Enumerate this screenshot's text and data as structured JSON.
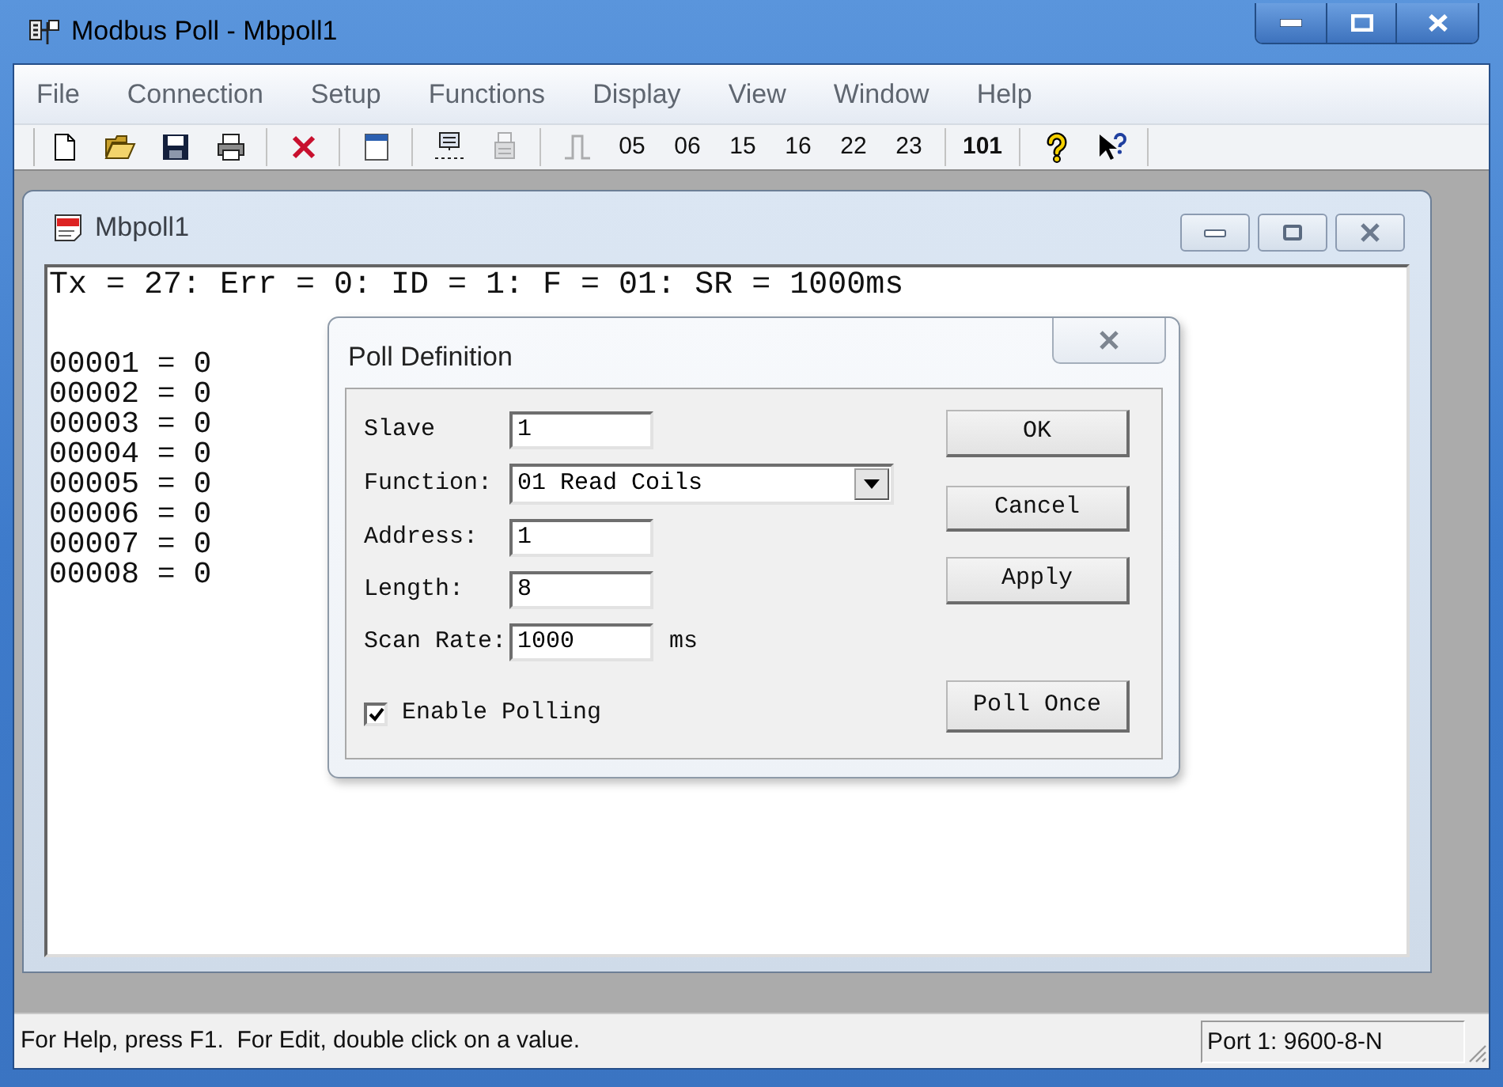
{
  "window": {
    "title": "Modbus Poll - Mbpoll1"
  },
  "menu": [
    "File",
    "Connection",
    "Setup",
    "Functions",
    "Display",
    "View",
    "Window",
    "Help"
  ],
  "toolbar": [
    {
      "kind": "icon",
      "disabled": false
    },
    {
      "kind": "icon",
      "disabled": false
    },
    {
      "kind": "icon",
      "disabled": false
    },
    {
      "kind": "icon",
      "disabled": false
    },
    {
      "kind": "separator"
    },
    {
      "kind": "icon",
      "disabled": false
    },
    {
      "kind": "separator"
    },
    {
      "kind": "icon",
      "disabled": false
    },
    {
      "kind": "separator"
    },
    {
      "kind": "icon",
      "disabled": false
    },
    {
      "kind": "icon",
      "disabled": true
    },
    {
      "kind": "separator"
    },
    {
      "kind": "icon",
      "disabled": true
    },
    {
      "kind": "text",
      "label": "05",
      "disabled": false
    },
    {
      "kind": "text",
      "label": "06",
      "disabled": false
    },
    {
      "kind": "text",
      "label": "15",
      "disabled": false
    },
    {
      "kind": "text",
      "label": "16",
      "disabled": false
    },
    {
      "kind": "text",
      "label": "22",
      "disabled": false
    },
    {
      "kind": "text",
      "label": "23",
      "disabled": false
    },
    {
      "kind": "separator"
    },
    {
      "kind": "text",
      "label": "101",
      "disabled": false
    },
    {
      "kind": "separator"
    },
    {
      "kind": "icon",
      "disabled": false
    },
    {
      "kind": "icon",
      "disabled": false
    },
    {
      "kind": "separator"
    }
  ],
  "document": {
    "title": "Mbpoll1",
    "status_line": "Tx = 27: Err = 0: ID = 1: F = 01: SR = 1000ms",
    "registers": [
      "00001 = 0",
      "00002 = 0",
      "00003 = 0",
      "00004 = 0",
      "00005 = 0",
      "00006 = 0",
      "00007 = 0",
      "00008 = 0"
    ]
  },
  "dialog": {
    "title": "Poll Definition",
    "fields": [
      {
        "kind": "text",
        "label": "Slave",
        "value": "1"
      },
      {
        "kind": "combo",
        "label": "Function:",
        "value": "01 Read Coils"
      },
      {
        "kind": "text",
        "label": "Address:",
        "value": "1"
      },
      {
        "kind": "text",
        "label": "Length:",
        "value": "8"
      },
      {
        "kind": "text",
        "label": "Scan Rate:",
        "value": "1000",
        "unit": "ms"
      }
    ],
    "checkbox": {
      "label": "Enable Polling",
      "checked": true
    },
    "buttons": [
      "OK",
      "Cancel",
      "Apply",
      "Poll Once"
    ]
  },
  "status_bar": {
    "message": "For Help, press F1.  For Edit, double click on a value.",
    "port": "Port 1: 9600-8-N"
  }
}
